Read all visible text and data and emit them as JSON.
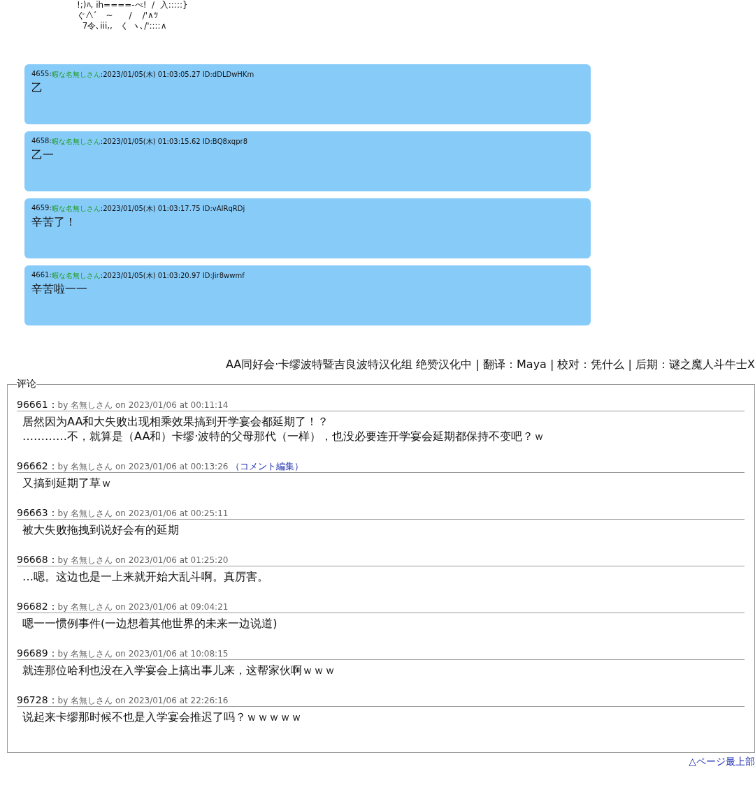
{
  "ascii_art": [
    "!;)ﾊ, ih====-ぺ!  /  入:::::}",
    "ぐ∧ﾞ   ~      /    /'∧ﾂ",
    "  7令､iii,,   く ヽ､/'::::∧"
  ],
  "posts": [
    {
      "number": "4655:",
      "name": "暇な名無しさん",
      "meta": ":2023/01/05(木) 01:03:05.27 ID:dDLDwHKm",
      "body": "乙"
    },
    {
      "number": "4658:",
      "name": "暇な名無しさん",
      "meta": ":2023/01/05(木) 01:03:15.62 ID:BQ8xqpr8",
      "body": "乙一"
    },
    {
      "number": "4659:",
      "name": "暇な名無しさん",
      "meta": ":2023/01/05(木) 01:03:17.75 ID:vAIRqRDj",
      "body": "辛苦了！"
    },
    {
      "number": "4661:",
      "name": "暇な名無しさん",
      "meta": ":2023/01/05(木) 01:03:20.97 ID:Jir8wwmf",
      "body": "辛苦啦一一"
    }
  ],
  "credits": "AA同好会·卡缪波特暨吉良波特汉化组 绝赞汉化中 | 翻译：Maya | 校对：凭什么 | 后期：谜之魔人斗牛士X",
  "comments": {
    "legend": "评论",
    "items": [
      {
        "number": "96661：",
        "meta": "by 名無しさん on 2023/01/06 at 00:11:14",
        "lines": [
          "居然因为AA和大失败出现相乘效果搞到开学宴会都延期了！？",
          "…………不，就算是（AA和）卡缪·波特的父母那代（一样），也没必要连开学宴会延期都保持不变吧？ｗ"
        ]
      },
      {
        "number": "96662：",
        "meta": "by 名無しさん on 2023/01/06 at 00:13:26",
        "edit_link": "（コメント編集）",
        "lines": [
          "又搞到延期了草ｗ"
        ]
      },
      {
        "number": "96663：",
        "meta": "by 名無しさん on 2023/01/06 at 00:25:11",
        "lines": [
          "被大失败拖拽到说好会有的延期"
        ]
      },
      {
        "number": "96668：",
        "meta": "by 名無しさん on 2023/01/06 at 01:25:20",
        "lines": [
          "…嗯。这边也是一上来就开始大乱斗啊。真厉害。"
        ]
      },
      {
        "number": "96682：",
        "meta": "by 名無しさん on 2023/01/06 at 09:04:21",
        "lines": [
          "嗯一一惯例事件(一边想着其他世界的未来一边说道)"
        ]
      },
      {
        "number": "96689：",
        "meta": "by 名無しさん on 2023/01/06 at 10:08:15",
        "lines": [
          "就连那位哈利也没在入学宴会上搞出事儿来，这帮家伙啊ｗｗｗ"
        ]
      },
      {
        "number": "96728：",
        "meta": "by 名無しさん on 2023/01/06 at 22:26:16",
        "lines": [
          "说起来卡缪那时候不也是入学宴会推迟了吗？ｗｗｗｗｗ"
        ]
      }
    ]
  },
  "page_top_link": "△ページ最上部"
}
